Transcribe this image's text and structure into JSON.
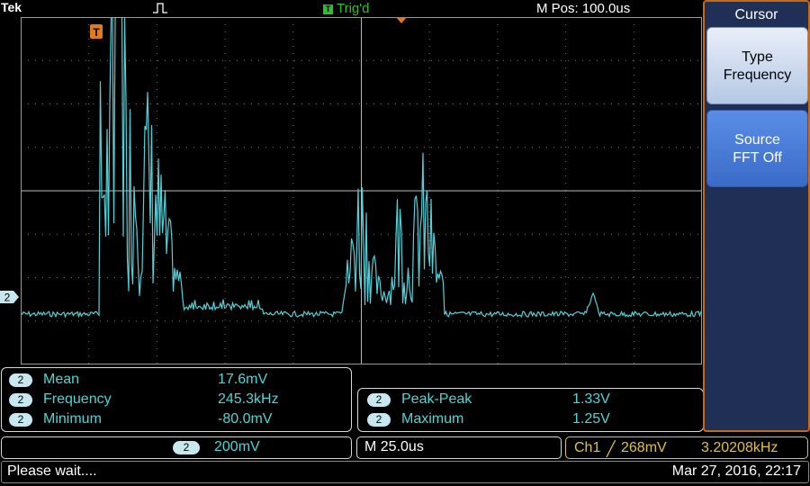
{
  "header": {
    "brand": "Tek",
    "trigger_state": "Trig'd",
    "trigger_badge": "T",
    "horizontal_position": "M Pos: 100.0us"
  },
  "waveform": {
    "channel_marker": "2",
    "trigger_marker": "T",
    "trace_color": "#55d0d8"
  },
  "measurements_left": [
    {
      "badge": "2",
      "label": "Mean",
      "value": "17.6mV"
    },
    {
      "badge": "2",
      "label": "Frequency",
      "value": "245.3kHz"
    },
    {
      "badge": "2",
      "label": "Minimum",
      "value": "-80.0mV"
    }
  ],
  "measurements_right": [
    {
      "badge": "2",
      "label": "Peak-Peak",
      "value": "1.33V"
    },
    {
      "badge": "2",
      "label": "Maximum",
      "value": "1.25V"
    }
  ],
  "status": {
    "channel_badge": "2",
    "vertical_scale": "200mV",
    "timebase": "M 25.0us",
    "trigger_channel": "Ch1",
    "trigger_slope": "╱",
    "trigger_level": "268mV",
    "trigger_frequency": "3.20208kHz"
  },
  "footer": {
    "message": "Please wait....",
    "datetime": "Mar 27, 2016, 22:17"
  },
  "side_menu": {
    "title": "Cursor",
    "buttons": [
      {
        "line1": "Type",
        "line2": "Frequency"
      },
      {
        "line1": "Source",
        "line2": "FFT Off"
      }
    ]
  },
  "colors": {
    "channel2": "#4dd6d6",
    "trigger_channel": "#e0c23a",
    "trigger_state": "#29c329",
    "trigger_marker": "#e07a1a",
    "menu_border": "#c46a18",
    "menu_bg": "#1f2f55"
  }
}
